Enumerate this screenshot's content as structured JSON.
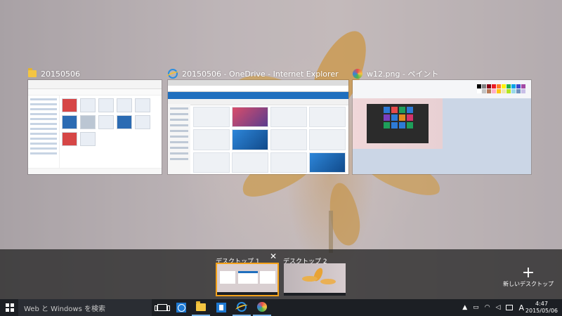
{
  "windows": [
    {
      "title": "20150506",
      "icon": "folder-icon"
    },
    {
      "title": "20150506 - OneDrive - Internet Explorer",
      "icon": "internet-explorer-icon"
    },
    {
      "title": "w12.png - ペイント",
      "icon": "paint-icon"
    }
  ],
  "virtual_desktops": [
    {
      "label": "デスクトップ 1",
      "active": true
    },
    {
      "label": "デスクトップ 2",
      "active": false
    }
  ],
  "close_glyph": "✕",
  "new_desktop": {
    "plus": "+",
    "label": "新しいデスクトップ"
  },
  "taskbar": {
    "search_placeholder": "Web と Windows を検索",
    "ime_label": "A",
    "time": "4:47",
    "date": "2015/05/06"
  },
  "colors": {
    "accent": "#f4a21a",
    "taskbar": "#1c1f24",
    "ie_blue": "#1e79d2"
  }
}
